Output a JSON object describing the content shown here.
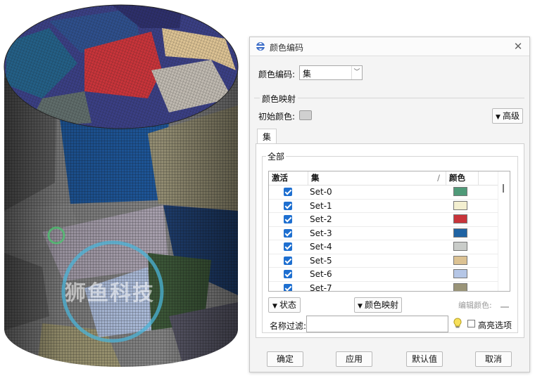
{
  "dialog": {
    "title": "颜色编码",
    "color_code_label": "颜色编码:",
    "color_code_value": "集",
    "color_map_group": "颜色映射",
    "initial_color_label": "初始颜色:",
    "advanced_label": "高级",
    "tab_label": "集",
    "all_group": "全部",
    "columns": {
      "active": "激活",
      "set": "集",
      "color": "颜色"
    },
    "rows": [
      {
        "name": "Set-0",
        "color": "#4f9a78",
        "active": true
      },
      {
        "name": "Set-1",
        "color": "#f3efd0",
        "active": true
      },
      {
        "name": "Set-2",
        "color": "#c8343a",
        "active": true
      },
      {
        "name": "Set-3",
        "color": "#1f63a3",
        "active": true
      },
      {
        "name": "Set-4",
        "color": "#c9ccc9",
        "active": true
      },
      {
        "name": "Set-5",
        "color": "#dcc293",
        "active": true
      },
      {
        "name": "Set-6",
        "color": "#b5c6e6",
        "active": true
      },
      {
        "name": "Set-7",
        "color": "#9a9478",
        "active": true
      }
    ],
    "status_button": "状态",
    "color_map_button": "颜色映射",
    "edit_color_label": "编辑颜色:",
    "name_filter_label": "名称过滤:",
    "name_filter_value": "",
    "highlight_label": "高亮选项",
    "ok_button": "确定",
    "apply_button": "应用",
    "defaults_button": "默认值",
    "cancel_button": "取消"
  },
  "watermark_text": "狮鱼科技",
  "mesh_colors": [
    "#1f5aa0",
    "#c8343a",
    "#dcc293",
    "#4f9a78",
    "#b5c6e6",
    "#9a9478",
    "#3a3f84"
  ]
}
